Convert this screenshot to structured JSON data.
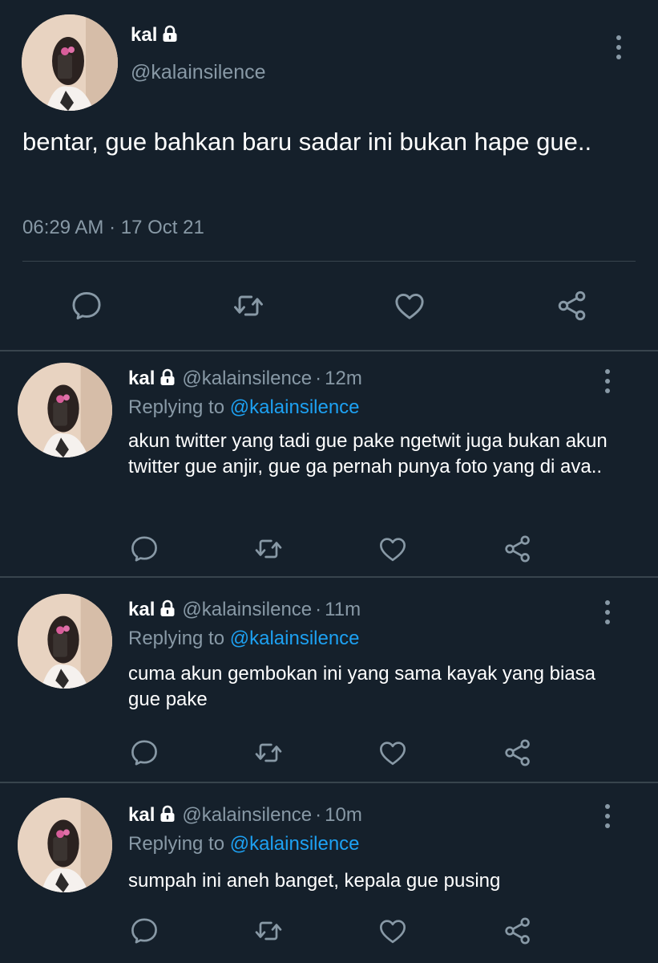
{
  "main_tweet": {
    "display_name": "kal",
    "handle": "@kalainsilence",
    "text": "bentar, gue bahkan baru sadar ini bukan hape gue..",
    "time": "06:29 AM",
    "date": "17 Oct 21"
  },
  "replies": [
    {
      "display_name": "kal",
      "handle": "@kalainsilence",
      "time_ago": "12m",
      "replying_label": "Replying to",
      "replying_to": "@kalainsilence",
      "text": "akun twitter yang tadi gue pake ngetwit juga bukan akun twitter gue anjir, gue ga pernah punya foto yang di ava.."
    },
    {
      "display_name": "kal",
      "handle": "@kalainsilence",
      "time_ago": "11m",
      "replying_label": "Replying to",
      "replying_to": "@kalainsilence",
      "text": "cuma akun gembokan ini yang sama kayak yang biasa gue pake"
    },
    {
      "display_name": "kal",
      "handle": "@kalainsilence",
      "time_ago": "10m",
      "replying_label": "Replying to",
      "replying_to": "@kalainsilence",
      "text": "sumpah ini aneh banget, kepala gue pusing"
    }
  ],
  "icons": {
    "reply": "reply-icon",
    "retweet": "retweet-icon",
    "like": "heart-icon",
    "share": "share-icon",
    "more": "more-options-icon",
    "lock": "lock-icon"
  },
  "colors": {
    "background": "#15202b",
    "secondary_text": "#8899a6",
    "link": "#1da1f2",
    "divider": "#38444d"
  }
}
